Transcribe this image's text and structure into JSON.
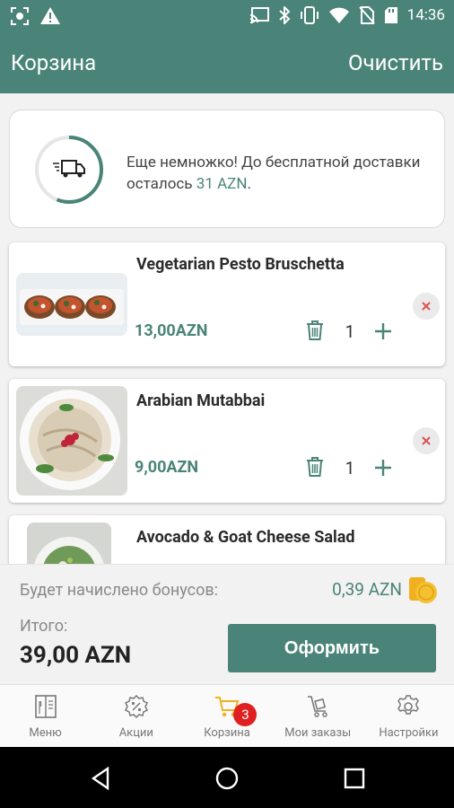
{
  "status_bar": {
    "time": "14:36",
    "icons": [
      "screenshot-icon",
      "alert-icon",
      "cast-icon",
      "bluetooth-icon",
      "vibrate-icon",
      "wifi-icon",
      "no-sim-icon",
      "sd-card-icon"
    ]
  },
  "app_bar": {
    "title": "Корзина",
    "clear_label": "Очистить"
  },
  "delivery": {
    "message_prefix": "Еще немножко! До бесплатной доставки осталось",
    "amount": "31 AZN",
    "suffix": ".",
    "progress_fraction": 0.56,
    "icon": "delivery-truck-icon"
  },
  "cart_items": [
    {
      "name": "Vegetarian Pesto Bruschetta",
      "price": "13,00AZN",
      "quantity": "1"
    },
    {
      "name": "Arabian Mutabbai",
      "price": "9,00AZN",
      "quantity": "1"
    },
    {
      "name": "Avocado & Goat Cheese Salad",
      "price": "",
      "quantity": ""
    }
  ],
  "summary": {
    "bonus_label": "Будет начислено бонусов:",
    "bonus_value": "0,39 AZN",
    "total_label": "Итого:",
    "total_value": "39,00 AZN",
    "checkout_label": "Оформить"
  },
  "bottom_nav": {
    "tabs": [
      {
        "label": "Меню",
        "icon": "menu-book-icon"
      },
      {
        "label": "Акции",
        "icon": "discount-icon"
      },
      {
        "label": "Корзина",
        "icon": "cart-icon",
        "badge": "3",
        "active": true
      },
      {
        "label": "Мои заказы",
        "icon": "orders-icon"
      },
      {
        "label": "Настройки",
        "icon": "settings-gear-icon"
      }
    ]
  },
  "colors": {
    "primary": "#4a8478",
    "accent": "#f0b020",
    "badge": "#e02020",
    "remove": "#d9534f"
  }
}
